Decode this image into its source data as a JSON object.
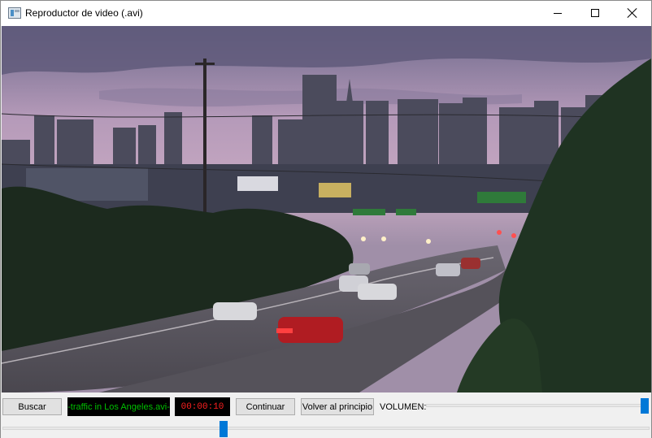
{
  "window": {
    "title": "Reproductor de video (.avi)"
  },
  "video": {
    "description_icon": "video-frame"
  },
  "controls": {
    "search_label": "Buscar",
    "filename": "-traffic in Los Angeles.avi-",
    "timecode": "00:00:10",
    "continue_label": "Continuar",
    "restart_label": "Volver al principio",
    "volume_label": "VOLUMEN:",
    "volume_level": 1.0,
    "seek_progress": 0.34
  },
  "colors": {
    "accent": "#0078d7",
    "filename_text": "#00c000",
    "timecode_text": "#ff2020"
  }
}
